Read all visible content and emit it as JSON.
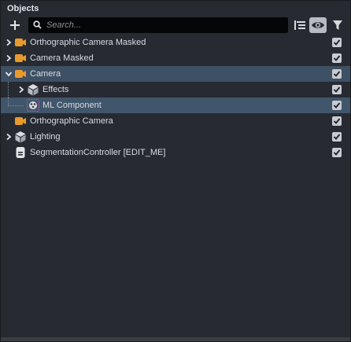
{
  "panel": {
    "title": "Objects"
  },
  "toolbar": {
    "add_icon": "plus-icon",
    "search_placeholder": "Search...",
    "search_value": "",
    "list_icon": "hierarchy-list-icon",
    "eye_icon": "eye-icon",
    "filter_icon": "filter-icon"
  },
  "tree": {
    "rows": [
      {
        "label": "Orthographic Camera Masked",
        "icon": "camera-icon",
        "expanded": false,
        "has_children": true,
        "depth": 0,
        "checked": true,
        "selected": false
      },
      {
        "label": "Camera Masked",
        "icon": "camera-icon",
        "expanded": false,
        "has_children": true,
        "depth": 0,
        "checked": true,
        "selected": false
      },
      {
        "label": "Camera",
        "icon": "camera-icon",
        "expanded": true,
        "has_children": true,
        "depth": 0,
        "checked": true,
        "selected": true
      },
      {
        "label": "Effects",
        "icon": "cube-icon",
        "expanded": false,
        "has_children": true,
        "depth": 1,
        "checked": true,
        "selected": false
      },
      {
        "label": "ML Component",
        "icon": "ml-component-icon",
        "expanded": false,
        "has_children": false,
        "depth": 1,
        "checked": true,
        "selected": true
      },
      {
        "label": "Orthographic Camera",
        "icon": "camera-icon",
        "expanded": false,
        "has_children": false,
        "depth": 0,
        "checked": true,
        "selected": false
      },
      {
        "label": "Lighting",
        "icon": "cube-icon",
        "expanded": false,
        "has_children": true,
        "depth": 0,
        "checked": true,
        "selected": false
      },
      {
        "label": "SegmentationController [EDIT_ME]",
        "icon": "script-icon",
        "expanded": false,
        "has_children": false,
        "depth": 0,
        "checked": true,
        "selected": false
      }
    ]
  },
  "colors": {
    "panel_bg": "#272a31",
    "selected_row": "#3e5064",
    "camera_icon": "#e89a2c",
    "ml_icon": "#c34ea5"
  }
}
